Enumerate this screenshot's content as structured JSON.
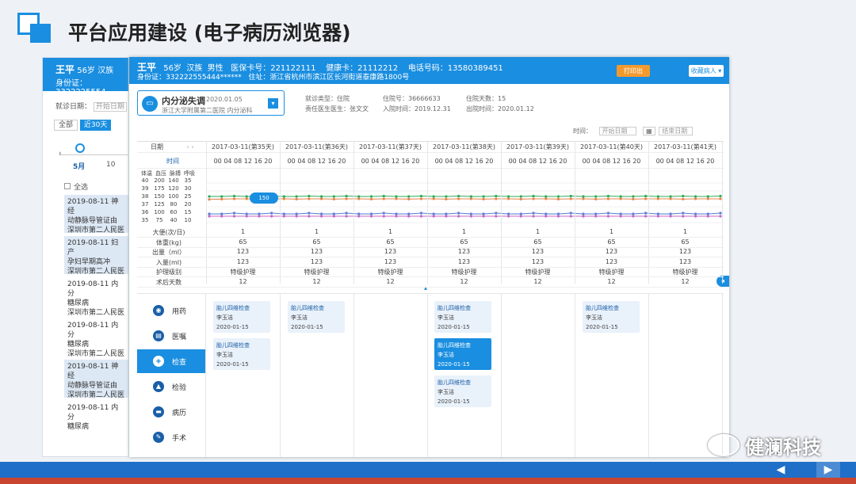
{
  "slide": {
    "title": "平台应用建设 (电子病历浏览器)",
    "watermark": "健澜科技"
  },
  "back_window": {
    "name": "王平",
    "age": "56岁",
    "ethnic": "汉族",
    "id_label": "身份证：",
    "id_value": "3322225554",
    "visit_date_label": "就诊日期：",
    "start_date_placeholder": "开始日期",
    "filters": [
      "全部",
      "近30天"
    ],
    "month": "5月",
    "next_month": "10",
    "select_all": "全选",
    "items": [
      {
        "date": "2019-08-11",
        "line2": "神经",
        "line3": "动静脉导管证由",
        "line4": "深圳市第二人民医院"
      },
      {
        "date": "2019-08-11",
        "line2": "妇产",
        "line3": "孕妇早期高冲",
        "line4": "深圳市第二人民医院"
      },
      {
        "date": "2019-08-11",
        "line2": "内分",
        "line3": "糖尿病",
        "line4": "深圳市第二人民医院"
      },
      {
        "date": "2019-08-11",
        "line2": "内分",
        "line3": "糖尿病",
        "line4": "深圳市第二人民医院"
      },
      {
        "date": "2019-08-11",
        "line2": "神经",
        "line3": "动静脉导管证由",
        "line4": "深圳市第二人民医院"
      },
      {
        "date": "2019-08-11",
        "line2": "内分",
        "line3": "糖尿病",
        "line4": ""
      }
    ]
  },
  "header": {
    "name": "王平",
    "age": "56岁",
    "ethnic": "汉族",
    "gender": "男性",
    "insurance": "医保卡号：221122111",
    "health_card": "健康卡：21112212",
    "phone": "电话号码：13580389451",
    "id_label": "身份证：",
    "id_value": "332222555444******",
    "address": "住址：浙江省杭州市滨江区长河街道泰康路1800号",
    "btn_out": "打印出",
    "btn_fav": "收藏病人 ▾"
  },
  "visit": {
    "title": "内分泌失调",
    "date": "2020.01.05",
    "hospital": "浙江大学附属第二医院  内分泌科"
  },
  "info": {
    "type": "就诊类型：住院",
    "inpatient_no": "住院号：36666633",
    "days": "住院天数：15",
    "doctor": "责任医生医生：张文文",
    "admit": "入院时间：2019.12.31",
    "discharge": "出院时间：2020.01.12"
  },
  "time_filter": {
    "label": "时间：",
    "start": "开始日期",
    "end": "结束日期"
  },
  "table": {
    "date_label": "日期",
    "time_label": "时间",
    "dates": [
      "2017-03-11(第35天)",
      "2017-03-11(第36天)",
      "2017-03-11(第37天)",
      "2017-03-11(第38天)",
      "2017-03-11(第39天)",
      "2017-03-11(第40天)",
      "2017-03-11(第41天)"
    ],
    "times": "00  04  08  12  16  20",
    "legend": [
      "体温",
      "血压",
      "脉搏",
      "呼吸"
    ],
    "yticks": [
      [
        "40",
        "200",
        "140",
        "35"
      ],
      [
        "39",
        "175",
        "120",
        "30"
      ],
      [
        "38",
        "150",
        "100",
        "25"
      ],
      [
        "37",
        "125",
        "80",
        "20"
      ],
      [
        "36",
        "100",
        "60",
        "15"
      ],
      [
        "35",
        "75",
        "40",
        "10"
      ]
    ],
    "tooltip": "150",
    "rows": [
      {
        "label": "大便(次/日)",
        "value": "1"
      },
      {
        "label": "体重(kg)",
        "value": "65"
      },
      {
        "label": "出量（ml）",
        "value": "123"
      },
      {
        "label": "入量(ml)",
        "value": "123"
      },
      {
        "label": "护理级别",
        "value": "特级护理"
      },
      {
        "label": "术后天数",
        "value": "12"
      }
    ]
  },
  "chart_data": {
    "type": "line",
    "series": [
      {
        "name": "血压",
        "color": "#e8844a",
        "values": [
          148,
          149,
          150,
          150,
          149,
          150,
          150,
          149,
          150,
          150,
          149,
          150,
          150,
          149,
          150,
          150,
          149,
          150,
          150,
          149,
          150,
          150,
          149,
          150,
          150,
          149,
          150,
          150,
          149,
          150,
          150,
          149,
          150,
          150,
          149,
          150,
          150,
          150,
          149,
          150,
          150,
          150
        ]
      },
      {
        "name": "脉搏",
        "color": "#2eaa5a",
        "values": [
          106,
          106,
          107,
          106,
          106,
          107,
          106,
          106,
          107,
          106,
          106,
          107,
          106,
          106,
          107,
          106,
          106,
          107,
          106,
          106,
          107,
          106,
          106,
          107,
          106,
          106,
          107,
          106,
          106,
          107,
          106,
          106,
          107,
          106,
          106,
          107,
          106,
          106,
          107,
          106,
          106,
          107
        ]
      },
      {
        "name": "体温",
        "color": "#5b7fd8",
        "values": [
          36.1,
          36.1,
          36.2,
          36.1,
          36.1,
          36.2,
          36.1,
          36.1,
          36.2,
          36.1,
          36.1,
          36.2,
          36.1,
          36.1,
          36.2,
          36.1,
          36.1,
          36.2,
          36.1,
          36.1,
          36.2,
          36.1,
          36.1,
          36.2,
          36.1,
          36.1,
          36.2,
          36.1,
          36.1,
          36.2,
          36.1,
          36.1,
          36.2,
          36.1,
          36.1,
          36.2,
          36.1,
          36.1,
          36.2,
          36.1,
          36.1,
          36.2
        ]
      },
      {
        "name": "呼吸",
        "color": "#c46ac8",
        "values": [
          14,
          14,
          14,
          14,
          14,
          14,
          14,
          14,
          14,
          14,
          14,
          14,
          14,
          14,
          14,
          14,
          14,
          14,
          14,
          14,
          14,
          14,
          14,
          14,
          14,
          14,
          14,
          14,
          14,
          14,
          14,
          14,
          14,
          14,
          14,
          14,
          14,
          14,
          14,
          14,
          14,
          14
        ]
      }
    ]
  },
  "menu": [
    "用药",
    "医嘱",
    "检查",
    "检验",
    "病历",
    "手术"
  ],
  "exam": {
    "title": "胎儿四维检查",
    "doctor": "李玉洁",
    "date": "2020-01-15"
  }
}
